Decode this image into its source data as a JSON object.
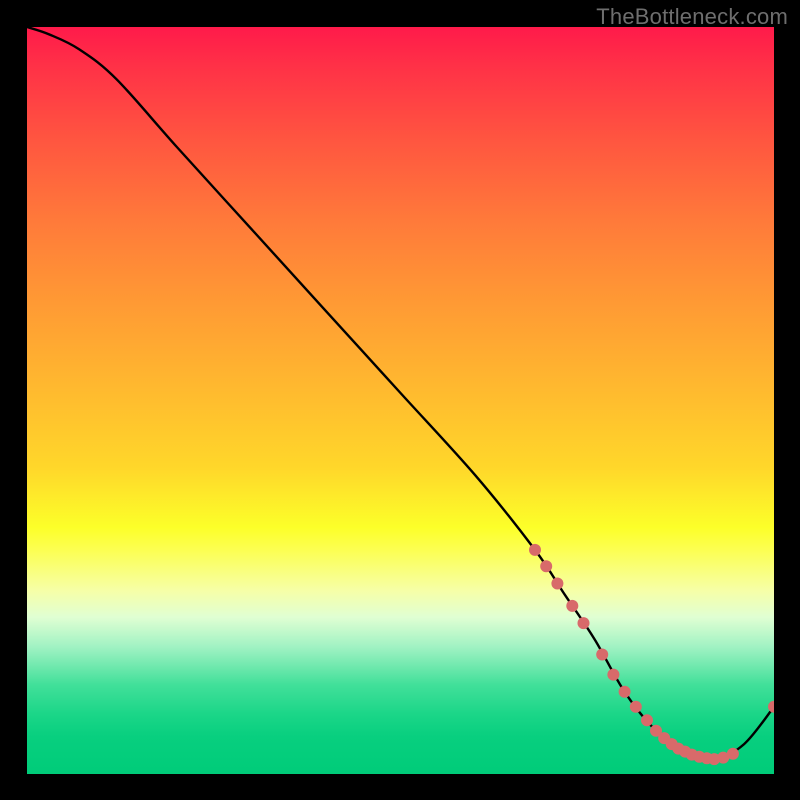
{
  "watermark": "TheBottleneck.com",
  "chart_data": {
    "type": "line",
    "title": "",
    "xlabel": "",
    "ylabel": "",
    "xlim": [
      0,
      100
    ],
    "ylim": [
      0,
      100
    ],
    "background_gradient": {
      "top_color": "#ff1a4a",
      "mid_color": "#ffd72a",
      "bottom_color": "#00cc79"
    },
    "series": [
      {
        "name": "bottleneck-curve",
        "color": "#000000",
        "x": [
          0,
          3,
          7,
          12,
          20,
          30,
          40,
          50,
          60,
          68,
          72,
          76,
          80,
          84,
          88,
          92,
          96,
          100
        ],
        "values": [
          100,
          99,
          97,
          93,
          84,
          73,
          62,
          51,
          40,
          30,
          24,
          18,
          11,
          6,
          3,
          2,
          4,
          9
        ]
      }
    ],
    "markers": {
      "name": "highlight-points",
      "color": "#d86a6a",
      "radius": 6,
      "x": [
        68.0,
        69.5,
        71.0,
        73.0,
        74.5,
        77.0,
        78.5,
        80.0,
        81.5,
        83.0,
        84.2,
        85.3,
        86.3,
        87.2,
        88.1,
        89.0,
        90.0,
        91.0,
        92.0,
        93.2,
        94.5,
        100.0
      ],
      "values": [
        30.0,
        27.8,
        25.5,
        22.5,
        20.2,
        16.0,
        13.3,
        11.0,
        9.0,
        7.2,
        5.8,
        4.8,
        4.0,
        3.4,
        3.0,
        2.6,
        2.3,
        2.1,
        2.0,
        2.2,
        2.7,
        9.0
      ]
    }
  }
}
